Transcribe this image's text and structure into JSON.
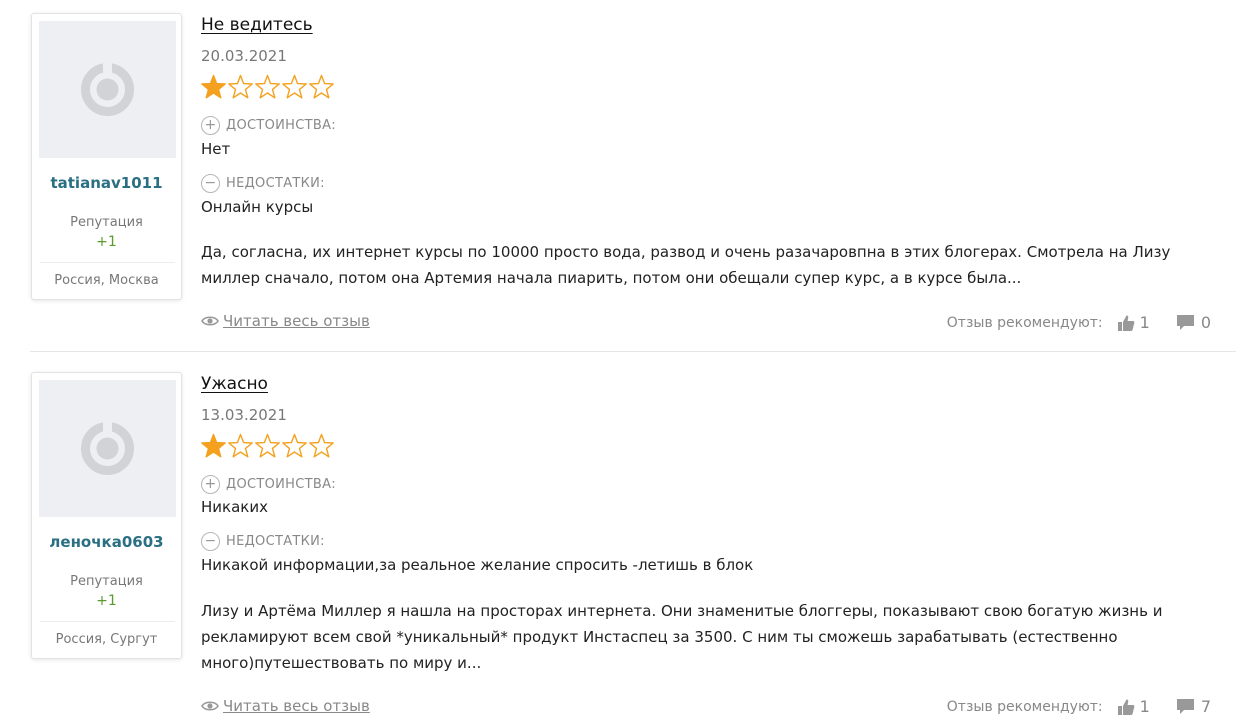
{
  "colors": {
    "username": "#2a6f82",
    "reputation": "#5b9a2e",
    "star_filled": "#f4a11f",
    "star_empty": "#f4a11f",
    "muted": "#888888",
    "divider": "#e6e6e6"
  },
  "labels": {
    "pros": "ДОСТОИНСТВА:",
    "cons": "НЕДОСТАТКИ:",
    "read_more": "Читать весь отзыв",
    "recommend": "Отзыв рекомендуют:",
    "reputation": "Репутация"
  },
  "icons": {
    "pros": "plus-circle-icon",
    "cons": "minus-circle-icon",
    "read_more": "eye-icon",
    "likes": "thumbs-up-icon",
    "comments": "comment-icon",
    "avatar": "default-avatar-icon"
  },
  "reviews": [
    {
      "author": "tatianav1011",
      "reputation_label": "Репутация",
      "reputation": "+1",
      "location": "Россия, Москва",
      "title": "Не ведитесь",
      "date": "20.03.2021",
      "rating": 1,
      "rating_max": 5,
      "pros": "Нет",
      "cons": "Онлайн курсы",
      "body": "Да, согласна, их интернет курсы по 10000 просто вода, развод и очень разачаровпна в этих блогерах. Смотрела на Лизу миллер сначало, потом она Артемия начала пиарить, потом они обещали супер курс, а в курсе была...",
      "likes": "1",
      "comments": "0"
    },
    {
      "author": "леночка0603",
      "reputation_label": "Репутация",
      "reputation": "+1",
      "location": "Россия, Сургут",
      "title": "Ужасно",
      "date": "13.03.2021",
      "rating": 1,
      "rating_max": 5,
      "pros": "Никаких",
      "cons": "Никакой информации,за реальное желание спросить -летишь в блок",
      "body": "Лизу и Артёма Миллер я нашла на просторах интернета. Они знаменитые блоггеры, показывают свою богатую жизнь и рекламируют всем свой *уникальный* продукт Инстаспец за 3500. С ним ты сможешь зарабатывать (естественно много)путешествовать по миру и...",
      "likes": "1",
      "comments": "7"
    }
  ]
}
